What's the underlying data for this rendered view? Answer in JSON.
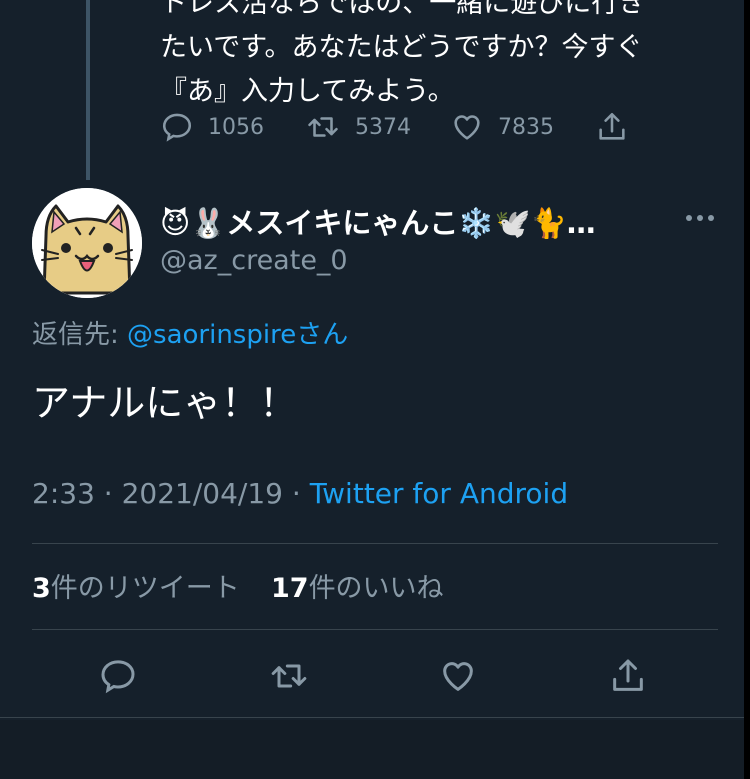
{
  "previous_tweet": {
    "text_lines": [
      "トレス活ならではの、一緒に遊びに行き",
      "たいです。あなたはどうですか？今すぐ",
      "『あ』入力してみよう。"
    ],
    "reply_count": "1056",
    "retweet_count": "5374",
    "like_count": "7835"
  },
  "tweet": {
    "display_name": "😈🐰メスイキにゃんこ❄️🕊️🐈…",
    "handle": "@az_create_0",
    "reply_to_label": "返信先: ",
    "reply_to_mention": "@saorinspire",
    "reply_to_suffix": "さん",
    "body": "アナルにゃ！！",
    "time": "2:33",
    "date": "2021/04/19",
    "separator": " · ",
    "source": "Twitter for Android",
    "retweets_number": "3",
    "retweets_label": "件のリツイート",
    "likes_number": "17",
    "likes_label": "件のいいね"
  },
  "colors": {
    "background": "#15202b",
    "secondary_text": "#8899a6",
    "link": "#1da1f2",
    "divider": "#38444d"
  },
  "icons": [
    "reply-icon",
    "retweet-icon",
    "like-icon",
    "share-icon",
    "more-icon",
    "avatar-cat"
  ]
}
